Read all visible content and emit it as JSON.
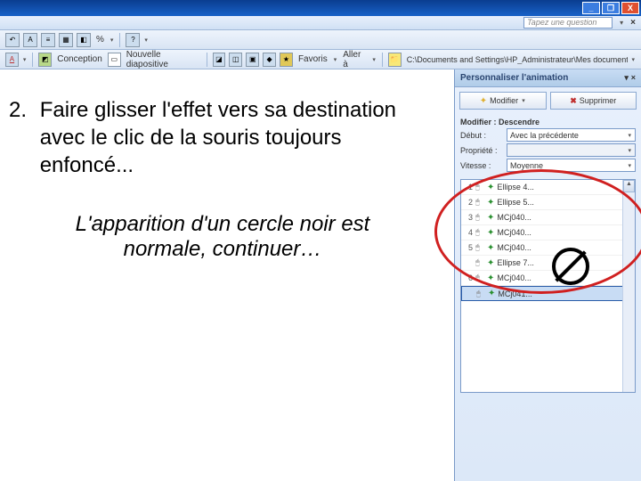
{
  "titlebar": {
    "min": "_",
    "max": "❐",
    "close": "X"
  },
  "questionbar": {
    "placeholder": "Tapez une question",
    "arrow": "▾",
    "x": "×"
  },
  "toolbar1": {
    "icons": [
      "↶",
      "A",
      "≡",
      "▦",
      "◧",
      "%",
      " ",
      "▾",
      "?",
      "▾"
    ]
  },
  "toolbar2": {
    "underline": "A",
    "conception": "Conception",
    "nouvelle": "Nouvelle diapositive",
    "favoris": "Favoris",
    "allera": "Aller à",
    "path": "C:\\Documents and Settings\\HP_Administrateur\\Mes documents\\Au"
  },
  "content": {
    "num": "2.",
    "text": "Faire glisser l'effet vers sa destination avec le clic de la souris toujours enfoncé...",
    "note": "L'apparition d'un cercle noir est normale, continuer…"
  },
  "taskpane": {
    "title": "Personnaliser l'animation",
    "modify": "Modifier",
    "delete": "Supprimer",
    "section": "Modifier : Descendre",
    "rows": {
      "start_label": "Début :",
      "start_value": "Avec la précédente",
      "prop_label": "Propriété :",
      "prop_value": "",
      "speed_label": "Vitesse :",
      "speed_value": "Moyenne"
    },
    "items": [
      {
        "n": "1",
        "name": "Ellipse 4..."
      },
      {
        "n": "2",
        "name": "Ellipse 5..."
      },
      {
        "n": "3",
        "name": "MCj040..."
      },
      {
        "n": "4",
        "name": "MCj040..."
      },
      {
        "n": "5",
        "name": "MCj040..."
      },
      {
        "n": "",
        "name": "Ellipse 7..."
      },
      {
        "n": "6",
        "name": "MCj040..."
      },
      {
        "n": "",
        "name": "MCj041..."
      }
    ]
  }
}
